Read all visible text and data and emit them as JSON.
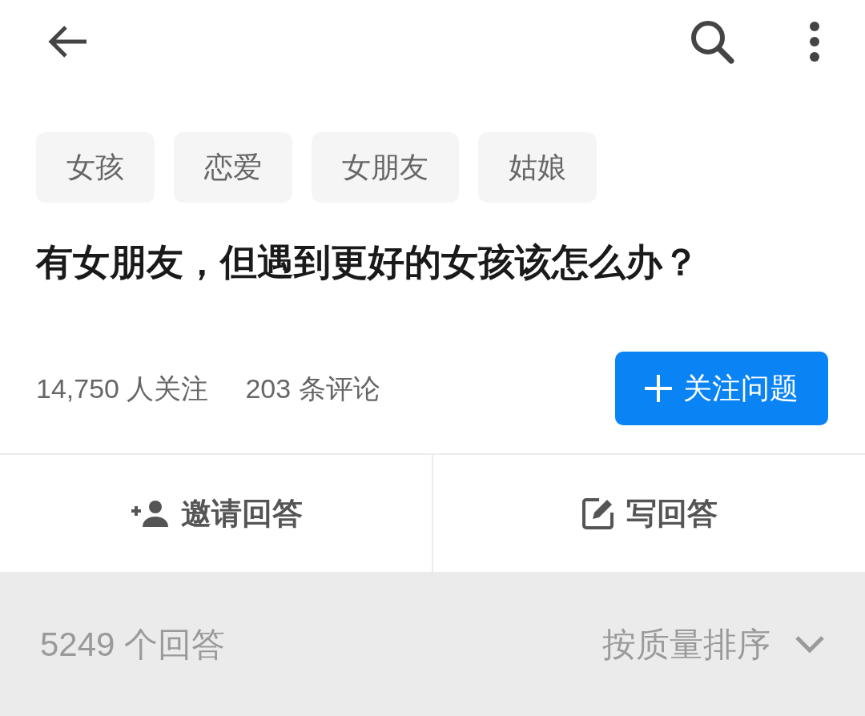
{
  "tags": [
    "女孩",
    "恋爱",
    "女朋友",
    "姑娘"
  ],
  "title": "有女朋友，但遇到更好的女孩该怎么办？",
  "stats": {
    "followers": "14,750 人关注",
    "comments": "203 条评论"
  },
  "follow_button": {
    "label": "关注问题"
  },
  "actions": [
    {
      "kind": "invite",
      "label": "邀请回答"
    },
    {
      "kind": "write",
      "label": "写回答"
    }
  ],
  "answers_bar": {
    "count": "5249 个回答",
    "sort": "按质量排序"
  }
}
